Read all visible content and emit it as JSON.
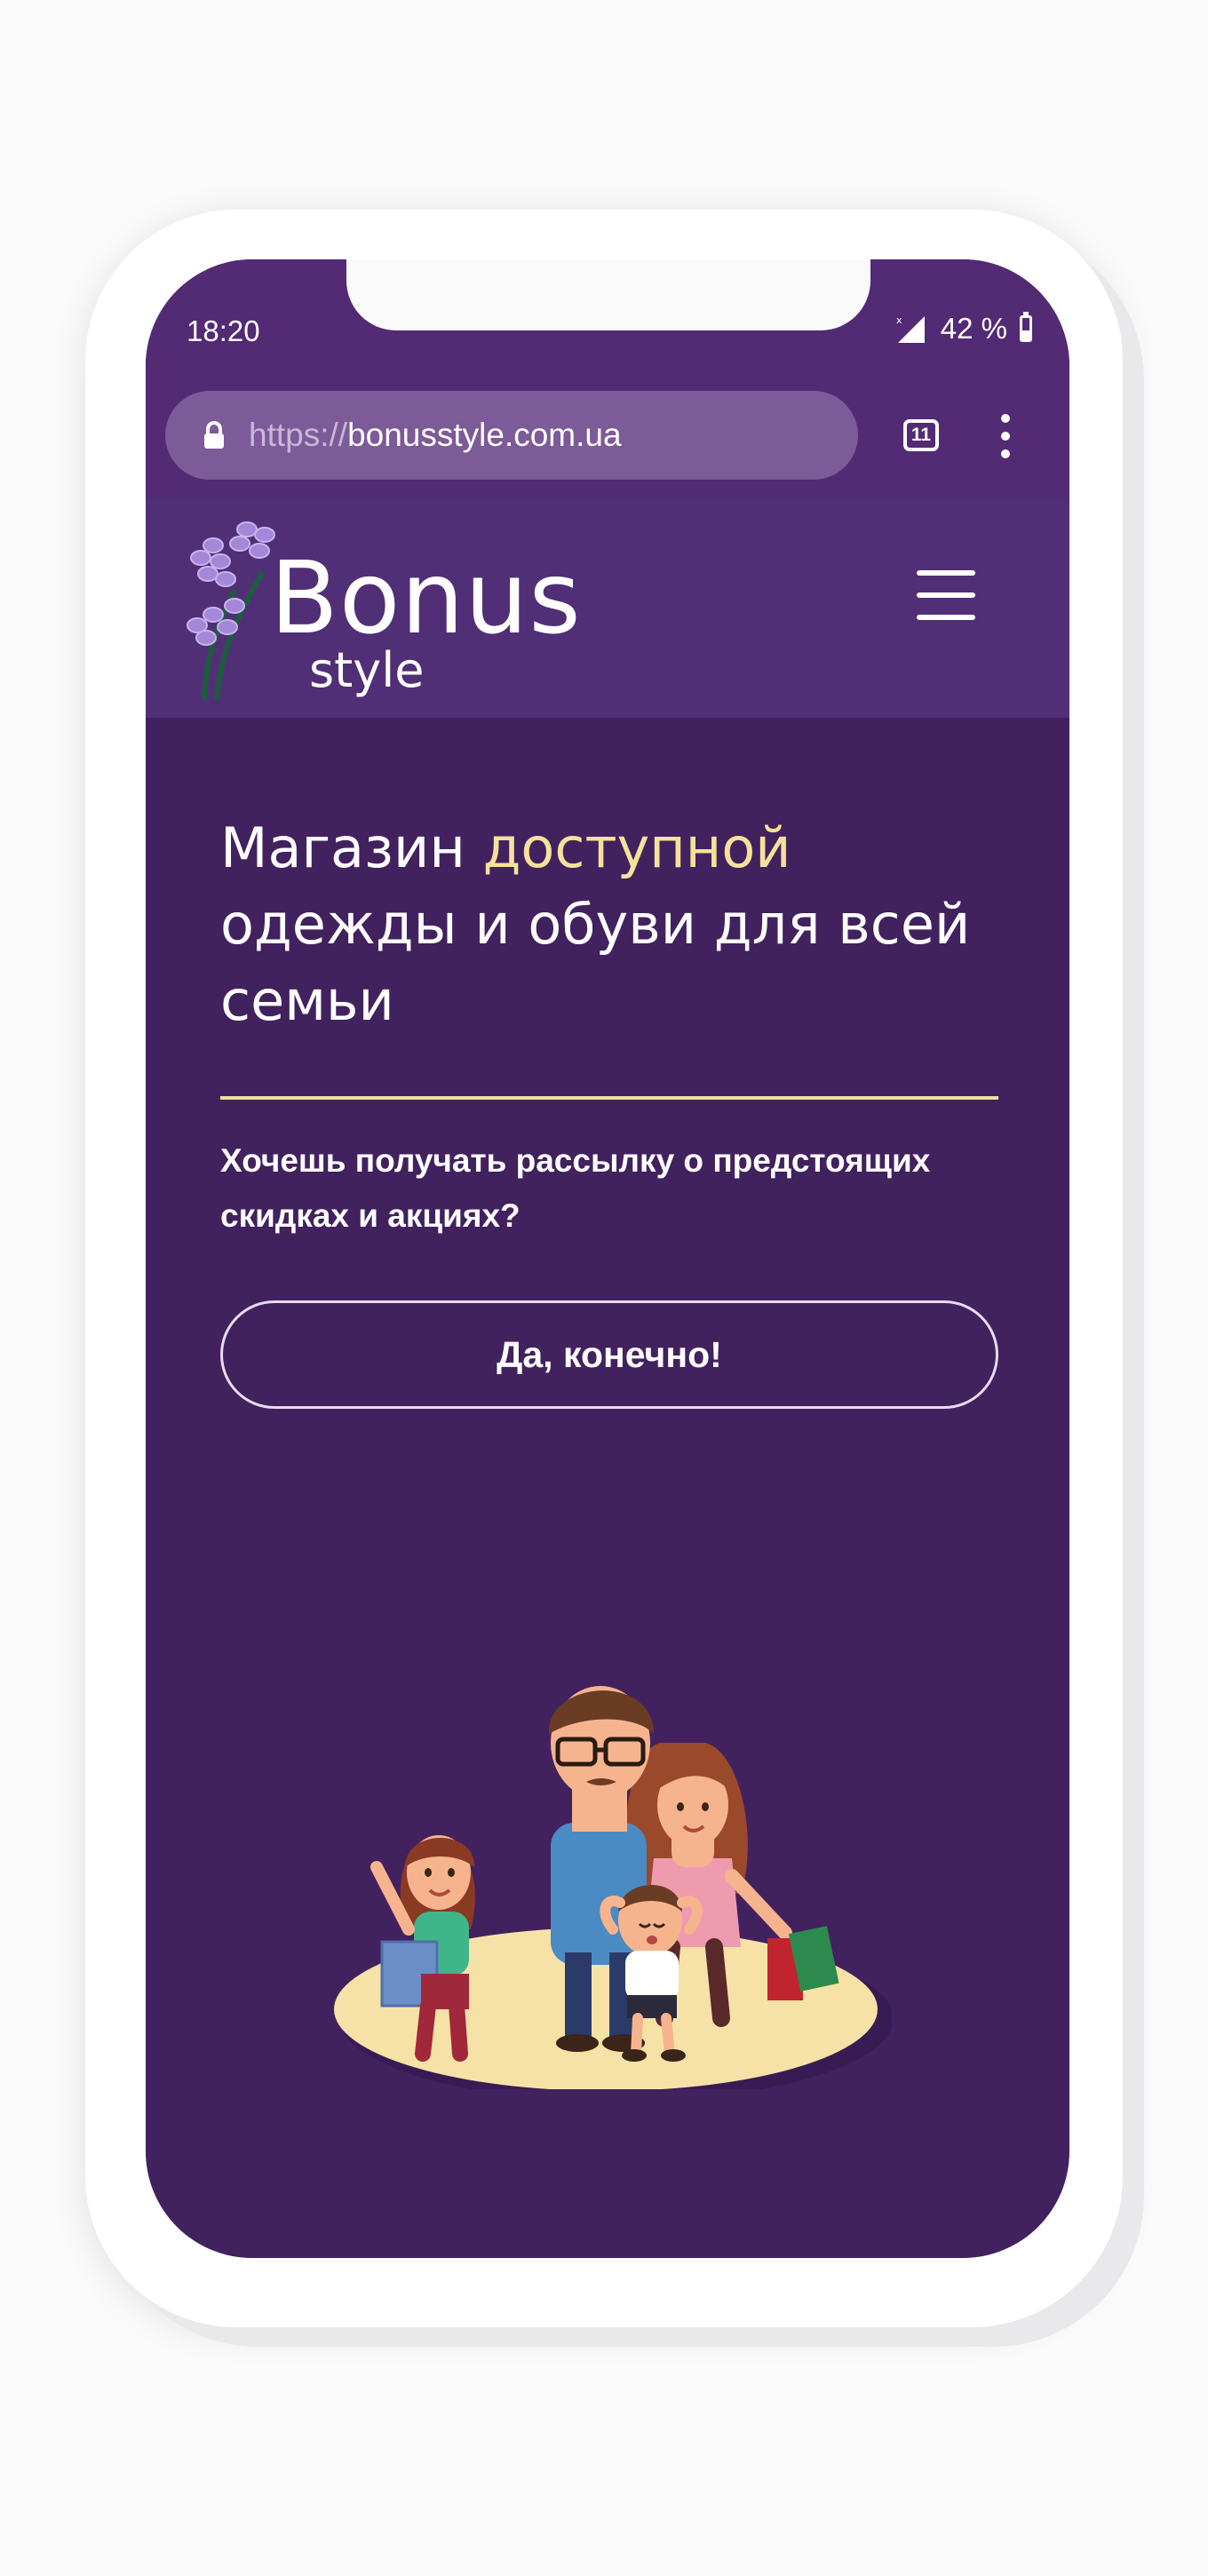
{
  "status_bar": {
    "time": "18:20",
    "battery": "42 %"
  },
  "browser": {
    "url_scheme": "https://",
    "url_host": "bonusstyle.com.ua",
    "tab_count": "11"
  },
  "header": {
    "logo_word": "Bonus",
    "logo_sub": "style"
  },
  "hero": {
    "title_start": "Магазин ",
    "title_accent": "доступной",
    "title_end": " одежды и обуви для всей семьи",
    "prompt": "Хочешь получать рассылку о предстоящих скидках и акциях?",
    "cta_label": "Да, конечно!"
  },
  "colors": {
    "screen_bg": "#42215f",
    "header_bg": "#512f77",
    "accent_yellow": "#f6e19a",
    "url_bar": "#7d5a98"
  },
  "icons": [
    "lock-icon",
    "signal-icon",
    "battery-icon",
    "tabs-icon",
    "kebab-menu-icon",
    "hamburger-icon",
    "lavender-logo-icon"
  ]
}
